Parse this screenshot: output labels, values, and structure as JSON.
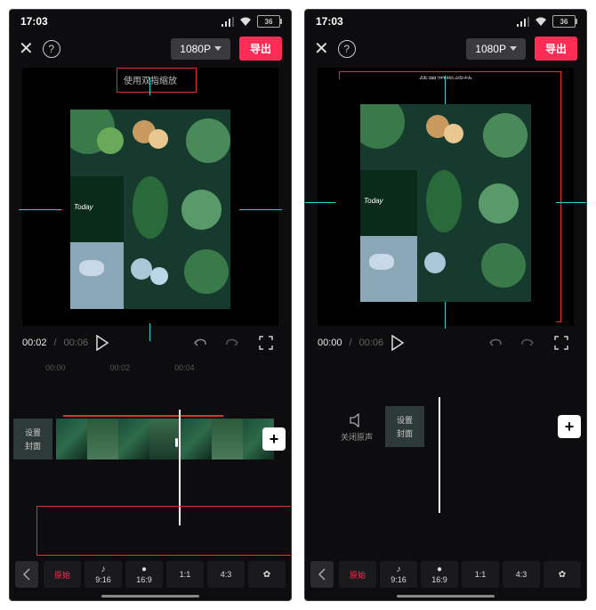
{
  "status": {
    "time": "17:03",
    "battery": "36"
  },
  "top": {
    "resolution": "1080P",
    "export": "导出"
  },
  "canvas_hint": "使用双指缩放",
  "playbar": {
    "cur": "00:02",
    "dur": "00:06"
  },
  "playbar2": {
    "cur": "00:00",
    "dur": "00:06"
  },
  "marks": [
    "00:00",
    "00:02",
    "00:04"
  ],
  "cover": {
    "l1": "设置",
    "l2": "封面"
  },
  "mute": "关闭原声",
  "ratios": [
    {
      "label": "原始",
      "active": true
    },
    {
      "label": "9:16",
      "icon": "♪"
    },
    {
      "label": "16:9",
      "icon": "●"
    },
    {
      "label": "1:1"
    },
    {
      "label": "4:3"
    },
    {
      "label": "",
      "icon": "✿"
    }
  ]
}
